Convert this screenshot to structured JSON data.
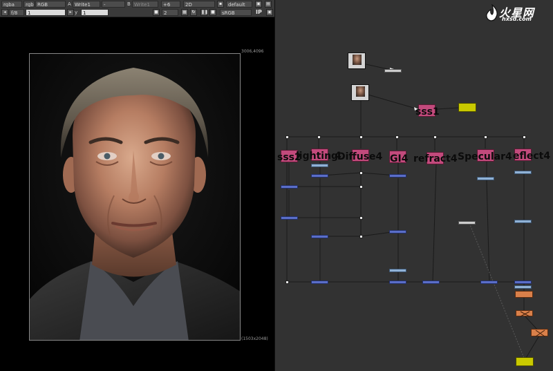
{
  "viewer": {
    "toolbar1": {
      "channels": "rgba",
      "layer": "rgba",
      "channel_sel": "RGB",
      "a_label": "A",
      "a_input": "Write1",
      "a_op": "-",
      "b_label": "B",
      "b_input": "Write1",
      "zoom": "+6",
      "view_mode": "2D",
      "lut": "default"
    },
    "toolbar2": {
      "fstop": "f/8",
      "frame": "1",
      "y_label": "y",
      "y_value": "1",
      "proxy": "2",
      "colorspace": "sRGB",
      "ip_label": "IP"
    },
    "format_top_right": "3006,4096",
    "format_bottom_right": "(1503x2048)"
  },
  "graph": {
    "nodes": {
      "sss1": "sss1",
      "sss2": "sss2",
      "lighting": "lighting",
      "diffuse": "Diffuse4",
      "gi": "GI4",
      "refract": "refract4",
      "specular": "Specular4",
      "reflect": "eflect4"
    },
    "number_overlays": {
      "lighting_num": "4",
      "diffuse_prefix": "D"
    },
    "watermark": {
      "main": "火星网",
      "sub": "hxsd.com"
    }
  },
  "colors": {
    "pink_node": "#c24a7c",
    "merge_node": "#5a6ec8",
    "grade_node": "#90b2d6",
    "write_node": "#c9c900",
    "graph_bg": "#323232"
  }
}
